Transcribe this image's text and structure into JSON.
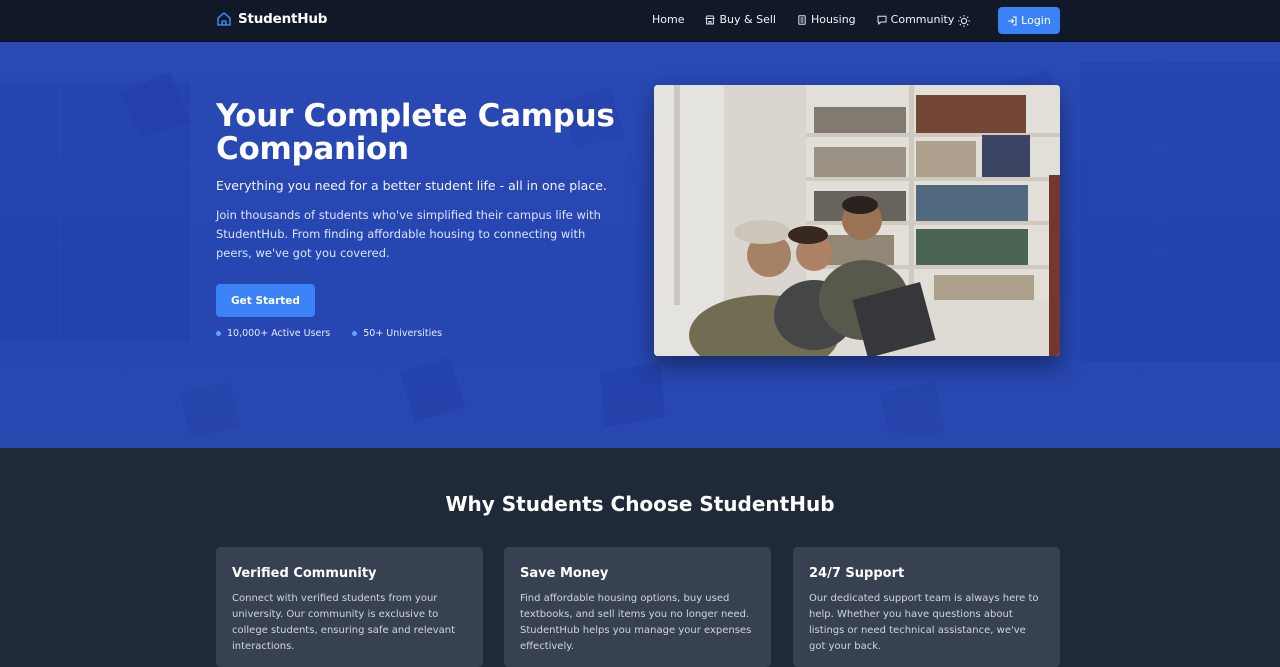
{
  "nav": {
    "brand": "StudentHub",
    "links": [
      {
        "label": "Home",
        "icon": ""
      },
      {
        "label": "Buy & Sell",
        "icon": "store-icon"
      },
      {
        "label": "Housing",
        "icon": "building-icon"
      },
      {
        "label": "Community",
        "icon": "chat-icon"
      }
    ],
    "theme_icon": "sun-icon",
    "login_label": "Login"
  },
  "hero": {
    "title": "Your Complete Campus Companion",
    "subtitle": "Everything you need for a better student life - all in one place.",
    "description": "Join thousands of students who've simplified their campus life with StudentHub. From finding affordable housing to connecting with peers, we've got you covered.",
    "cta_label": "Get Started",
    "stats": [
      "10,000+ Active Users",
      "50+ Universities"
    ]
  },
  "features": {
    "title": "Why Students Choose StudentHub",
    "cards": [
      {
        "title": "Verified Community",
        "text": "Connect with verified students from your university. Our community is exclusive to college students, ensuring safe and relevant interactions."
      },
      {
        "title": "Save Money",
        "text": "Find affordable housing options, buy used textbooks, and sell items you no longer need. StudentHub helps you manage your expenses effectively."
      },
      {
        "title": "24/7 Support",
        "text": "Our dedicated support team is always here to help. Whether you have questions about listings or need technical assistance, we've got your back."
      }
    ]
  },
  "colors": {
    "accent": "#3b82f6",
    "hero_bg": "#2646b2",
    "nav_bg": "#111827",
    "section_bg": "#1f2937",
    "card_bg": "#374151"
  }
}
